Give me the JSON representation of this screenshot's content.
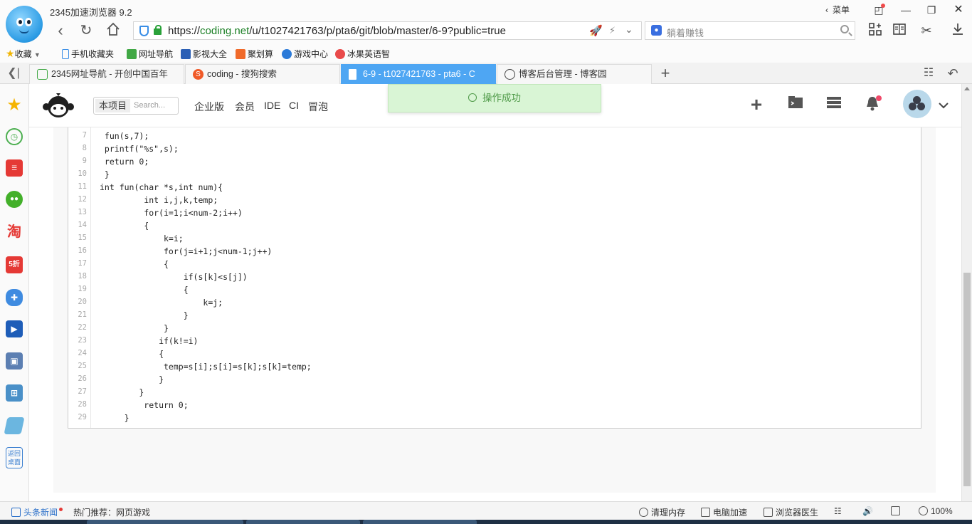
{
  "browser": {
    "app_title": "2345加速浏览器 9.2",
    "url_prefix": "https://",
    "url_domain": "coding.net",
    "url_path": "/u/t1027421763/p/pta6/git/blob/master/6-9?public=true",
    "search_placeholder": "躺着赚钱",
    "menu_label": "菜单"
  },
  "bookmarks": [
    {
      "label": "收藏",
      "icon": "star-icon",
      "color": "#f0b400"
    },
    {
      "label": "手机收藏夹",
      "icon": "phone-icon",
      "color": "#3a8ee6"
    },
    {
      "label": "网址导航",
      "icon": "nav-icon",
      "color": "#41a845"
    },
    {
      "label": "影视大全",
      "icon": "video-icon",
      "color": "#2b5fb5"
    },
    {
      "label": "聚划算",
      "icon": "deal-icon",
      "color": "#f06a2a"
    },
    {
      "label": "游戏中心",
      "icon": "game-icon",
      "color": "#2b7ad8"
    },
    {
      "label": "冰果英语智",
      "icon": "english-icon",
      "color": "#e94a4a"
    }
  ],
  "tabs": [
    {
      "label": "2345网址导航 - 开创中国百年",
      "active": false
    },
    {
      "label": "coding - 搜狗搜索",
      "active": false
    },
    {
      "label": "6-9 - t1027421763 - pta6 - C",
      "active": true
    },
    {
      "label": "博客后台管理 - 博客园",
      "active": false
    }
  ],
  "sidebar": [
    {
      "name": "favorites-icon"
    },
    {
      "name": "history-icon"
    },
    {
      "name": "news-icon"
    },
    {
      "name": "wechat-icon"
    },
    {
      "name": "taobao-icon",
      "glyph": "淘"
    },
    {
      "name": "discount-icon",
      "glyph": "5折"
    },
    {
      "name": "gamepad-icon"
    },
    {
      "name": "film-icon"
    },
    {
      "name": "computer-icon"
    },
    {
      "name": "calculator-icon"
    },
    {
      "name": "eraser-icon"
    },
    {
      "name": "back-to-desktop-icon",
      "glyph": "返回桌面"
    }
  ],
  "site": {
    "search_scope": "本项目",
    "search_placeholder": "Search...",
    "nav": [
      "企业版",
      "会员",
      "IDE",
      "CI",
      "冒泡"
    ]
  },
  "toast": {
    "icon": "smile-icon",
    "text": "操作成功"
  },
  "code": {
    "line_numbers": [
      "7",
      "8",
      "9",
      "10",
      "11",
      "12",
      "13",
      "14",
      "15",
      "16",
      "17",
      "18",
      "19",
      "20",
      "21",
      "22",
      "23",
      "24",
      "25",
      "26",
      "27",
      "28",
      "29"
    ],
    "lines": [
      " fun(s,7);",
      " printf(\"%s\",s);",
      " return 0;",
      " }",
      "int fun(char *s,int num){",
      "         int i,j,k,temp;",
      "         for(i=1;i<num-2;i++)",
      "         {",
      "             k=i;",
      "             for(j=i+1;j<num-1;j++)",
      "             {",
      "                 if(s[k]<s[j])",
      "                 {",
      "                     k=j;",
      "                 }",
      "             }",
      "            if(k!=i)",
      "            {",
      "             temp=s[i];s[i]=s[k];s[k]=temp;",
      "            }",
      "        }",
      "         return 0;",
      "     }"
    ]
  },
  "statusbar": {
    "news": "头条新闻",
    "recommend": "热门推荐：网页游戏",
    "clear_memory": "清理内存",
    "pc_speedup": "电脑加速",
    "browser_doctor": "浏览器医生",
    "zoom": "100%"
  },
  "colors": {
    "accent": "#4ea6f3",
    "toast_bg": "#d9f5d5",
    "toast_text": "#4f9a48",
    "url_domain": "#1a7f24"
  }
}
